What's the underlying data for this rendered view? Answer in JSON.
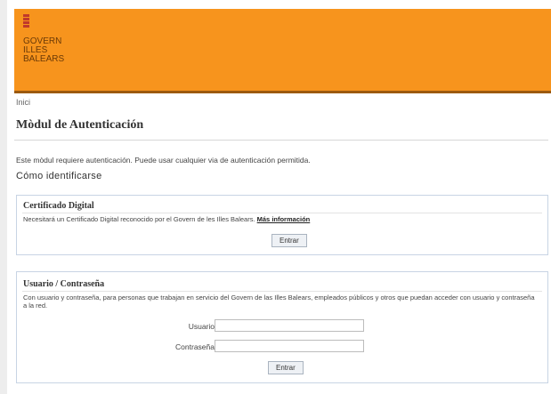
{
  "header": {
    "logo_lines": [
      "GOVERN",
      "ILLES",
      "BALEARS"
    ],
    "colors": {
      "background": "#f7941d",
      "logo_mark": "#c0392b"
    }
  },
  "breadcrumb": "Inici",
  "page_title": "Mòdul de Autenticación",
  "intro": "Este mòdul requiere autenticación. Puede usar cualquier via de autenticación permitida.",
  "how_heading": "Cómo identificarse",
  "certificate_panel": {
    "title": "Certificado Digital",
    "description": "Necesitará un Certificado Digital reconocido por el Govern de les Illes Balears.",
    "link": "Más información",
    "button": "Entrar"
  },
  "user_panel": {
    "title": "Usuario / Contraseña",
    "description": "Con usuario y contraseña, para personas que trabajan en servicio del Govern de las Illes Balears, empleados públicos y otros que puedan acceder con usuario y contraseña a la red.",
    "username_label": "Usuario",
    "username_value": "",
    "password_label": "Contraseña",
    "password_value": "",
    "button": "Entrar"
  }
}
